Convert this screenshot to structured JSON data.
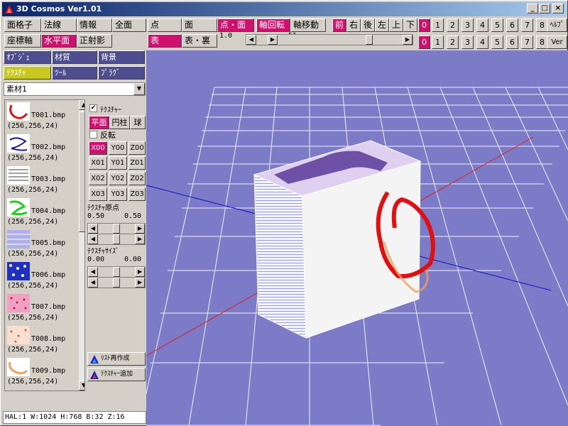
{
  "window": {
    "title": "3D Cosmos Ver1.01",
    "min_label": "_",
    "max_label": "□",
    "close_label": "×"
  },
  "toolbar": {
    "row1": [
      "面格子",
      "法線",
      "情報",
      "全面",
      "点",
      "面",
      "点・面",
      "軸回転",
      "軸移動"
    ],
    "row2": [
      "座標軸",
      "水平面",
      "正射影"
    ],
    "row2_right": [
      "表",
      "表・裏"
    ],
    "views": [
      "前",
      "右",
      "後",
      "左",
      "上",
      "下"
    ],
    "numbers_row1": [
      "0",
      "1",
      "2",
      "3",
      "4",
      "5",
      "6",
      "7",
      "8",
      "ﾍﾙﾌﾟ"
    ],
    "numbers_row2": [
      "0",
      "1",
      "2",
      "3",
      "4",
      "5",
      "6",
      "7",
      "8",
      "Ver"
    ],
    "slider_left_value": "1.0",
    "slider_right_value": "51",
    "slider_fraction": 0.75
  },
  "tabs": {
    "row1": [
      "ｵﾌﾞｼﾞｪ",
      "材質",
      "背景"
    ],
    "row2": [
      "ﾃｸｽﾁｬ",
      "ﾂｰﾙ",
      "ﾌﾟﾗｸﾞ"
    ]
  },
  "material_select": {
    "value": "素材1"
  },
  "texture_list": [
    {
      "name": "T001.bmp",
      "size": "(256,256,24)"
    },
    {
      "name": "T002.bmp",
      "size": "(256,256,24)"
    },
    {
      "name": "T003.bmp",
      "size": "(256,256,24)"
    },
    {
      "name": "T004.bmp",
      "size": "(256,256,24)"
    },
    {
      "name": "T005.bmp",
      "size": "(256,256,24)"
    },
    {
      "name": "T006.bmp",
      "size": "(256,256,24)"
    },
    {
      "name": "T007.bmp",
      "size": "(256,256,24)"
    },
    {
      "name": "T008.bmp",
      "size": "(256,256,24)"
    },
    {
      "name": "T009.bmp",
      "size": "(256,256,24)"
    }
  ],
  "texture_panel": {
    "texture_check_label": "ﾃｸｽﾁｬｰ",
    "mapping": [
      "平面",
      "円柱",
      "球"
    ],
    "reverse_label": "反転",
    "axis_grid": [
      "X00",
      "Y00",
      "Z00",
      "X01",
      "Y01",
      "Z01",
      "X02",
      "Y02",
      "Z02",
      "X03",
      "Y03",
      "Z03"
    ],
    "origin_label": "ﾃｸｽﾁｬ原点",
    "origin_values": [
      "0.50",
      "0.50"
    ],
    "size_label": "ﾃｸｽﾁｬｻｲｽﾞ",
    "size_values": [
      "0.00",
      "0.00"
    ],
    "rebuild_list": "ﾘｽﾄ再作成",
    "add_texture": "ﾃｸｽﾁｬｰ追加"
  },
  "status": "HAL:1 W:1024 H:768 B:32 Z:16",
  "colors": {
    "accent_pink": "#d0106e",
    "panel_navy": "#4d4d90",
    "viewport_bg": "#7b7bc8",
    "tab_yellow": "#c8c820"
  }
}
